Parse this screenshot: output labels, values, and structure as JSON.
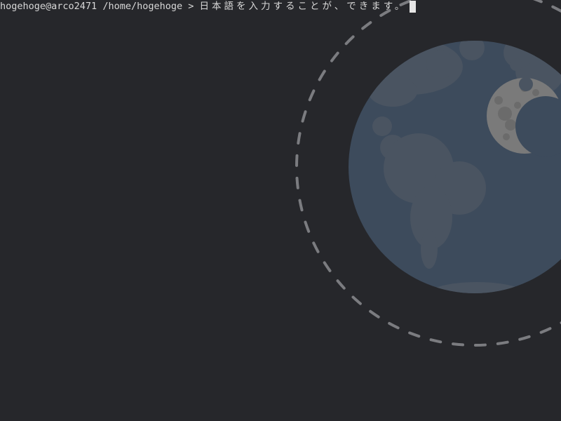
{
  "terminal": {
    "user_host": "hogehoge@arco2471",
    "cwd": "/home/hogehoge",
    "prompt_symbol": ">",
    "input_text": "日本語を入力することが、できます。"
  },
  "wallpaper": {
    "theme": "earth-and-moon",
    "background_color": "#26272b",
    "earth_color": "#3d4b5c",
    "land_color": "#4d5660",
    "moon_color": "#7a7a7a",
    "orbit_color": "#7b7c80"
  }
}
